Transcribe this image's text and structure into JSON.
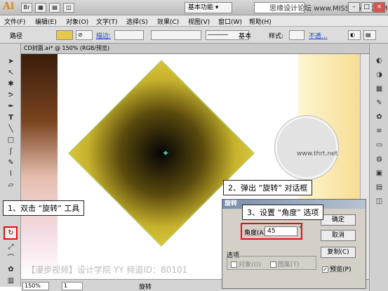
{
  "app": {
    "logo": "Ai",
    "workspace": "基本功能 ▾",
    "watermark": "思缘设计论坛 www.MISSYUAN.COM"
  },
  "menu": [
    "文件(F)",
    "编辑(E)",
    "对象(O)",
    "文字(T)",
    "选择(S)",
    "效果(C)",
    "视图(V)",
    "窗口(W)",
    "帮助(H)"
  ],
  "control": {
    "path_label": "路径",
    "stroke_label": "描边:",
    "basic": "基本",
    "style_label": "样式:",
    "opacity": "不透..."
  },
  "document": {
    "tab": "CD封面.ai* @ 150% (RGB/预览)",
    "art_text": "www.thrt.net",
    "canvas_watermark": "【漫步视频】设计学院 YY 频道ID：80101"
  },
  "statusbar": {
    "zoom": "150%",
    "page": "1",
    "tool": "旋转"
  },
  "callouts": {
    "step1": "1、双击 “旋转” 工具",
    "step2": "2、弹出 “旋转” 对话框",
    "step3": "3、设置 “角度” 选项"
  },
  "dialog": {
    "title": "旋转",
    "angle_label": "角度(A):",
    "angle_value": "45",
    "degree_symbol": "°",
    "ok": "确定",
    "cancel": "取消",
    "copy": "复制(C)",
    "options_label": "选项",
    "objects": "对象(O)",
    "patterns": "图案(T)",
    "preview": "预览(P)"
  }
}
